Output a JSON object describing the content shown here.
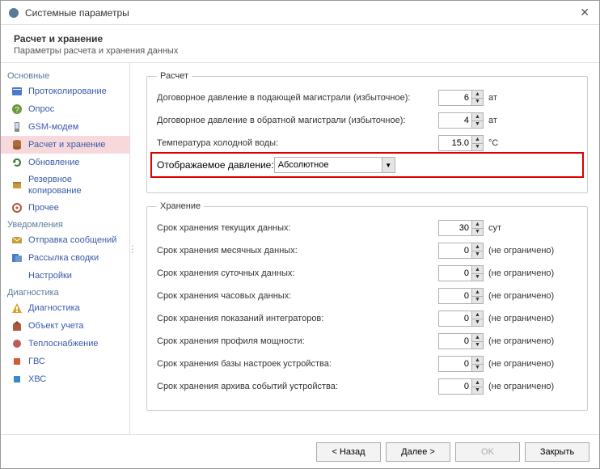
{
  "window": {
    "title": "Системные параметры"
  },
  "header": {
    "title": "Расчет и хранение",
    "subtitle": "Параметры расчета и хранения данных"
  },
  "sidebar": {
    "groups": [
      {
        "label": "Основные",
        "items": [
          {
            "label": "Протоколирование",
            "icon": "proto"
          },
          {
            "label": "Опрос",
            "icon": "ask"
          },
          {
            "label": "GSM-модем",
            "icon": "gsm"
          },
          {
            "label": "Расчет и хранение",
            "icon": "db",
            "selected": true
          },
          {
            "label": "Обновление",
            "icon": "refresh"
          },
          {
            "label": "Резервное копирование",
            "icon": "backup"
          },
          {
            "label": "Прочее",
            "icon": "other"
          }
        ]
      },
      {
        "label": "Уведомления",
        "items": [
          {
            "label": "Отправка сообщений",
            "icon": "mail"
          },
          {
            "label": "Рассылка сводки",
            "icon": "dist"
          },
          {
            "label": "Настройки",
            "icon": "none"
          }
        ]
      },
      {
        "label": "Диагностика",
        "items": [
          {
            "label": "Диагностика",
            "icon": "warn"
          },
          {
            "label": "Объект учета",
            "icon": "obj"
          },
          {
            "label": "Теплоснабжение",
            "icon": "heat"
          },
          {
            "label": "ГВС",
            "icon": "gvs"
          },
          {
            "label": "ХВС",
            "icon": "hvs"
          }
        ]
      }
    ]
  },
  "calc": {
    "legend": "Расчет",
    "rows": [
      {
        "label": "Договорное давление в подающей магистрали (избыточное):",
        "value": "6",
        "unit": "ат"
      },
      {
        "label": "Договорное давление в обратной магистрали (избыточное):",
        "value": "4",
        "unit": "ат"
      },
      {
        "label": "Температура холодной воды:",
        "value": "15.0",
        "unit": "°C"
      }
    ],
    "displayed": {
      "label": "Отображаемое давление:",
      "value": "Абсолютное"
    }
  },
  "storage": {
    "legend": "Хранение",
    "rows": [
      {
        "label": "Срок хранения текущих данных:",
        "value": "30",
        "unit": "сут"
      },
      {
        "label": "Срок хранения месячных данных:",
        "value": "0",
        "unit": "(не ограничено)"
      },
      {
        "label": "Срок хранения суточных данных:",
        "value": "0",
        "unit": "(не ограничено)"
      },
      {
        "label": "Срок хранения часовых данных:",
        "value": "0",
        "unit": "(не ограничено)"
      },
      {
        "label": "Срок хранения показаний интеграторов:",
        "value": "0",
        "unit": "(не ограничено)"
      },
      {
        "label": "Срок хранения профиля мощности:",
        "value": "0",
        "unit": "(не ограничено)"
      },
      {
        "label": "Срок хранения базы настроек устройства:",
        "value": "0",
        "unit": "(не ограничено)"
      },
      {
        "label": "Срок хранения архива событий устройства:",
        "value": "0",
        "unit": "(не ограничено)"
      }
    ]
  },
  "footer": {
    "back": "< Назад",
    "next": "Далее >",
    "ok": "OK",
    "close": "Закрыть"
  }
}
